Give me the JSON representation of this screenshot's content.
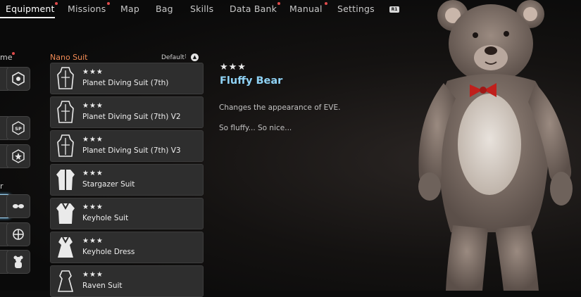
{
  "tabs": [
    {
      "label": "Equipment",
      "active": true,
      "alert": true
    },
    {
      "label": "Missions",
      "alert": true
    },
    {
      "label": "Map",
      "alert": false
    },
    {
      "label": "Bag",
      "alert": false
    },
    {
      "label": "Skills",
      "alert": false
    },
    {
      "label": "Data Bank",
      "alert": true
    },
    {
      "label": "Manual",
      "alert": true
    },
    {
      "label": "Settings",
      "alert": false
    }
  ],
  "tab_next_hint": "R1",
  "side": {
    "label_top": "me",
    "label_mid": "r"
  },
  "list": {
    "title": "Nano Suit",
    "sort_label": "Default",
    "sort_icon": "triangle-button-icon",
    "items": [
      {
        "stars": "★★★",
        "name": "Planet Diving Suit (7th)",
        "icon": "diving-suit-icon"
      },
      {
        "stars": "★★★",
        "name": "Planet Diving Suit (7th) V2",
        "icon": "diving-suit-icon"
      },
      {
        "stars": "★★★",
        "name": "Planet Diving Suit (7th) V3",
        "icon": "diving-suit-icon"
      },
      {
        "stars": "★★★",
        "name": "Stargazer Suit",
        "icon": "jacket-suit-icon"
      },
      {
        "stars": "★★★",
        "name": "Keyhole Suit",
        "icon": "jacket-suit-icon"
      },
      {
        "stars": "★★★",
        "name": "Keyhole Dress",
        "icon": "dress-icon"
      },
      {
        "stars": "★★★",
        "name": "Raven Suit",
        "icon": "dress-icon"
      }
    ]
  },
  "detail": {
    "stars": "★★★",
    "title": "Fluffy Bear",
    "description": "Changes the appearance of EVE.",
    "flavor": "So fluffy... So nice..."
  },
  "colors": {
    "accent_title": "#8fd2f5",
    "list_header": "#f08a55",
    "alert_dot": "#e14b4b"
  }
}
